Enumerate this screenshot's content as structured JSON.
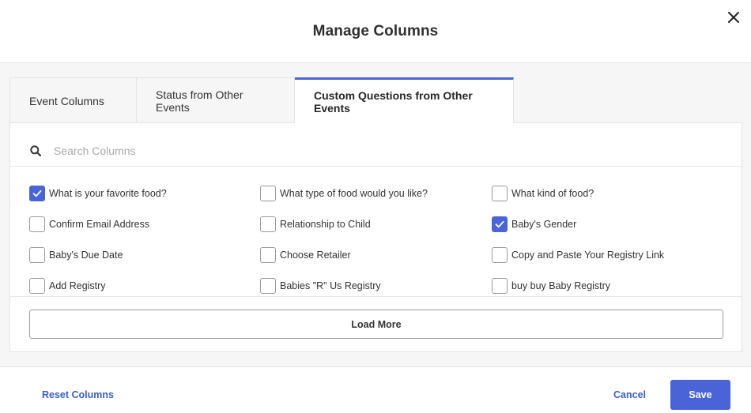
{
  "modal": {
    "title": "Manage Columns",
    "close_icon": "close-icon"
  },
  "tabs": [
    {
      "label": "Event Columns",
      "active": false
    },
    {
      "label": "Status from Other Events",
      "active": false
    },
    {
      "label": "Custom Questions from Other Events",
      "active": true
    }
  ],
  "search": {
    "placeholder": "Search Columns",
    "value": "",
    "icon": "search-icon"
  },
  "options": [
    {
      "label": "What is your favorite food?",
      "checked": true
    },
    {
      "label": "What type of food would you like?",
      "checked": false
    },
    {
      "label": "What kind of food?",
      "checked": false
    },
    {
      "label": "Confirm Email Address",
      "checked": false
    },
    {
      "label": "Relationship to Child",
      "checked": false
    },
    {
      "label": "Baby's Gender",
      "checked": true
    },
    {
      "label": "Baby's Due Date",
      "checked": false
    },
    {
      "label": "Choose Retailer",
      "checked": false
    },
    {
      "label": "Copy and Paste Your Registry Link",
      "checked": false
    },
    {
      "label": "Add Registry",
      "checked": false
    },
    {
      "label": "Babies \"R\" Us Registry",
      "checked": false
    },
    {
      "label": "buy buy Baby Registry",
      "checked": false
    }
  ],
  "load_more_label": "Load More",
  "footer": {
    "reset_label": "Reset Columns",
    "cancel_label": "Cancel",
    "save_label": "Save"
  },
  "colors": {
    "accent": "#4a64d8",
    "link": "#3b5ed0",
    "panel_bg": "#f6f6f6"
  }
}
